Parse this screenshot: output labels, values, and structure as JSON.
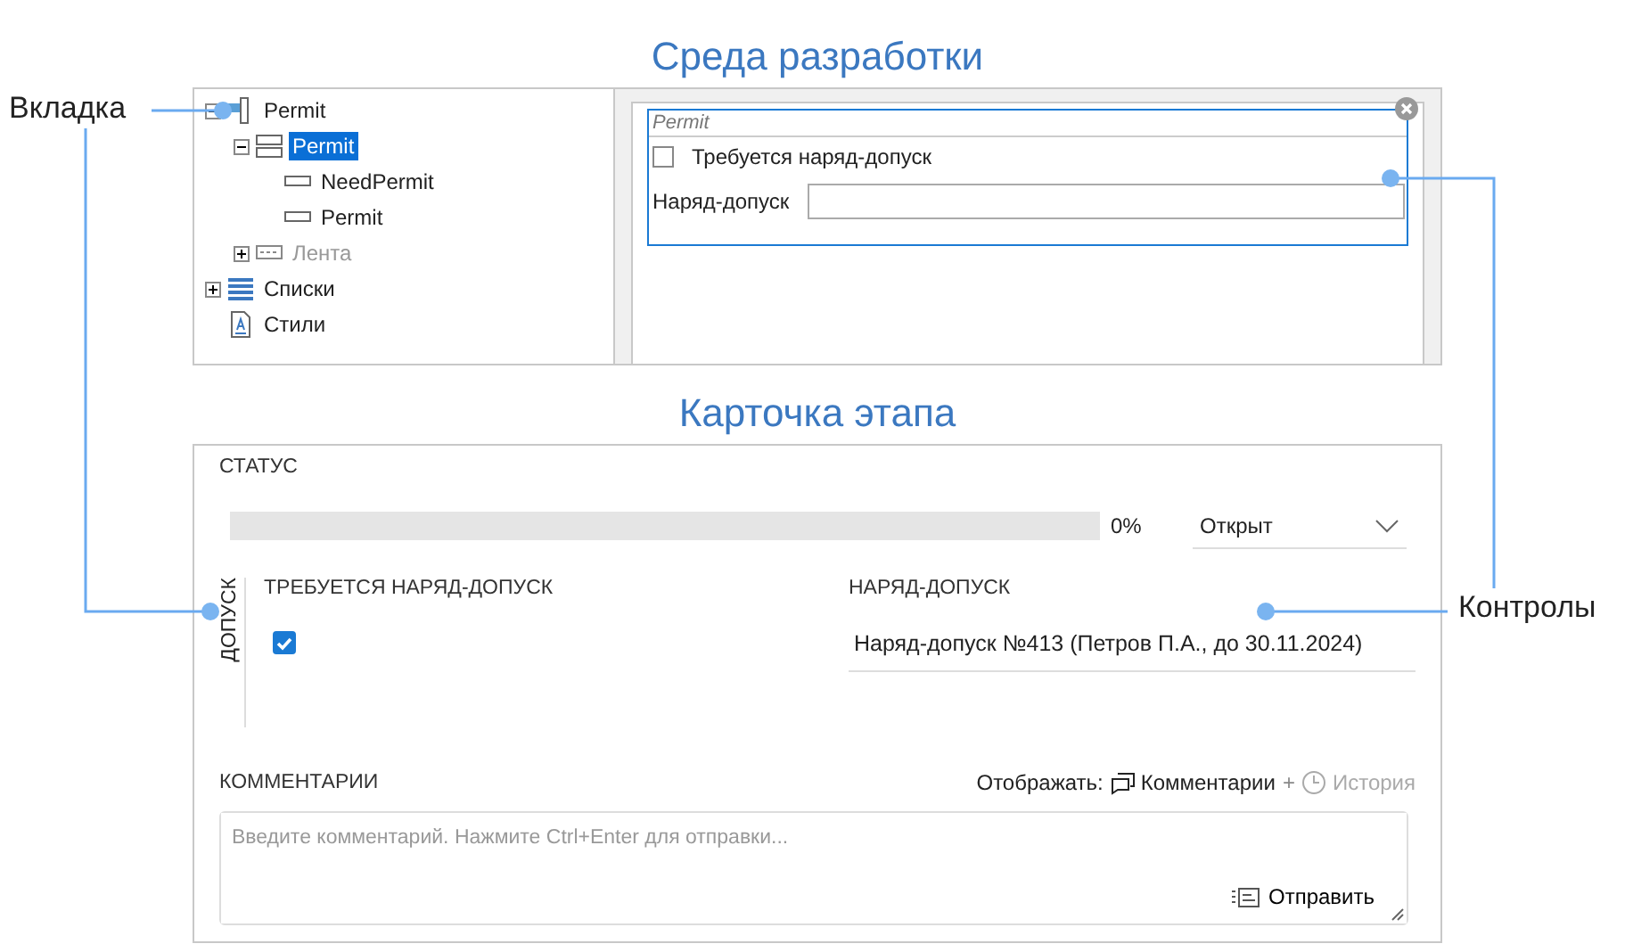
{
  "dev_title": "Среда разработки",
  "tree": [
    {
      "label": "Permit",
      "kind": "field",
      "expanded": true,
      "selected": false,
      "disabled": false,
      "children": [
        {
          "label": "Permit",
          "kind": "group",
          "expanded": true,
          "selected": true,
          "disabled": false,
          "children": [
            {
              "label": "NeedPermit",
              "kind": "input",
              "selected": false,
              "disabled": false
            },
            {
              "label": "Permit",
              "kind": "input",
              "selected": false,
              "disabled": false
            }
          ]
        },
        {
          "label": "Лента",
          "kind": "ribbon",
          "expanded": false,
          "selected": false,
          "disabled": true
        }
      ]
    },
    {
      "label": "Списки",
      "kind": "list",
      "expanded": false,
      "selected": false,
      "disabled": false
    },
    {
      "label": "Стили",
      "kind": "style",
      "selected": false,
      "disabled": false
    }
  ],
  "designer": {
    "caption": "Permit",
    "checkbox": {
      "label": "Требуется наряд-допуск",
      "checked": false
    },
    "field": {
      "label": "Наряд-допуск"
    }
  },
  "card_title": "Карточка этапа",
  "card": {
    "status_label": "СТАТУС",
    "progress": {
      "level": 0,
      "reading": "0%"
    },
    "status_value": "Открыт",
    "group_label": "ДОПУСК",
    "need_permit": {
      "label": "ТРЕБУЕТСЯ НАРЯД-ДОПУСК",
      "checked": true
    },
    "permit": {
      "label": "НАРЯД-ДОПУСК",
      "value": "Наряд-допуск №413 (Петров П.А., до 30.11.2024)"
    },
    "comments_label": "КОММЕНТАРИИ",
    "show_label": "Отображать:",
    "separator": "+",
    "toggles": [
      {
        "label": "Комментарии",
        "kind": "chat",
        "selected": true
      },
      {
        "label": "История",
        "kind": "clock",
        "selected": false
      }
    ],
    "comment_placeholder": "Введите комментарий. Нажмите Ctrl+Enter для отправки...",
    "send": "Отправить"
  },
  "callouts": [
    {
      "label": "Вкладка"
    },
    {
      "label": "Контролы"
    }
  ]
}
